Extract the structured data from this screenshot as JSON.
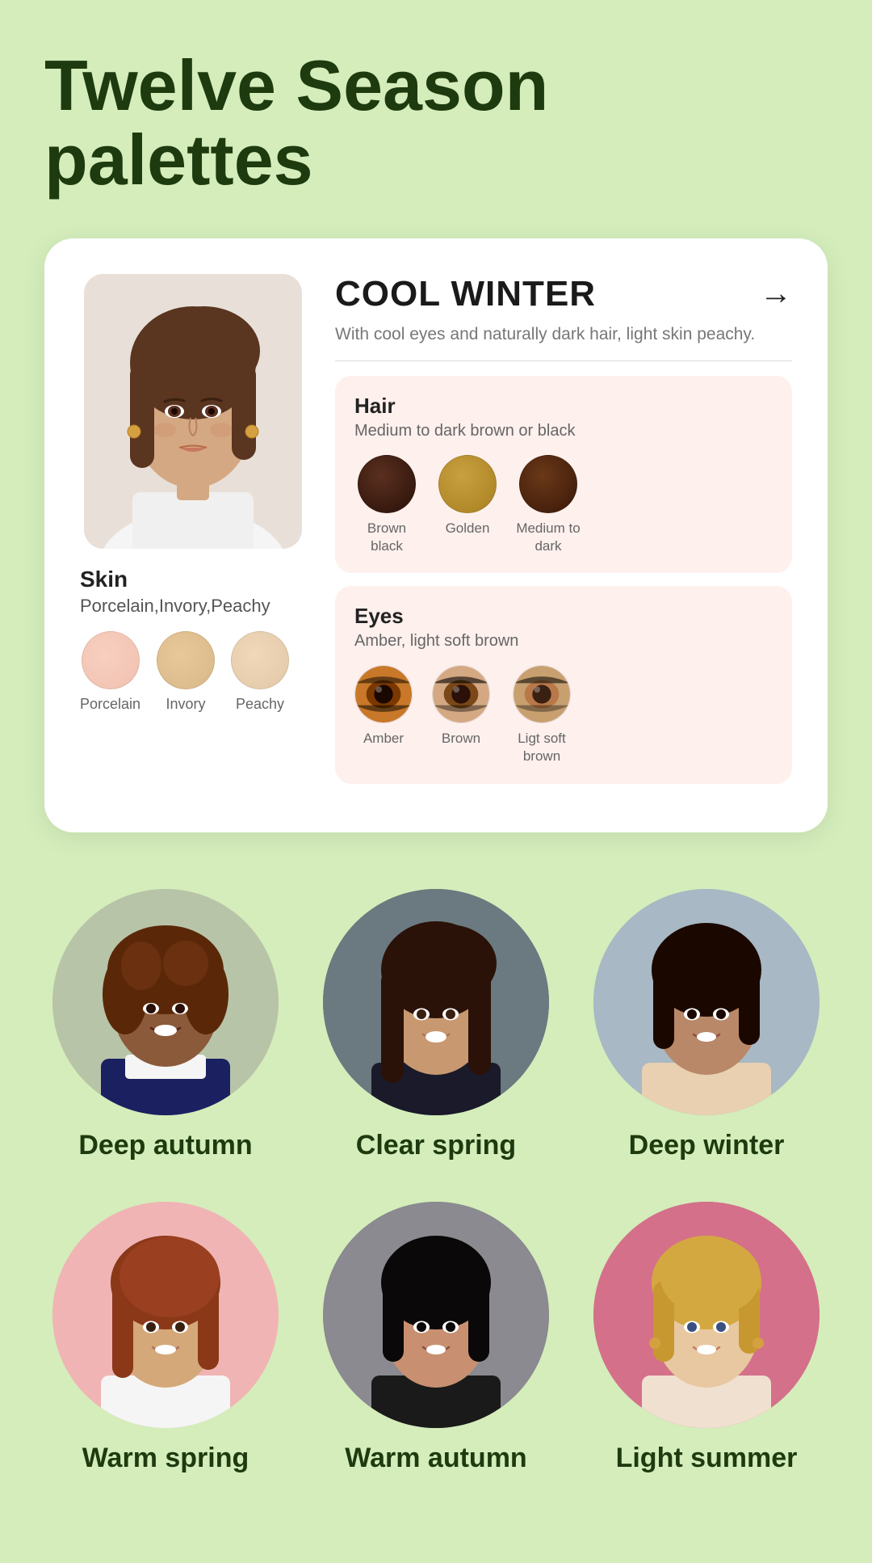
{
  "title": {
    "line1": "Twelve Season",
    "line2": "palettes"
  },
  "card": {
    "season": {
      "name": "COOL WINTER",
      "description": "With cool eyes and naturally dark hair, light skin peachy.",
      "arrow": "→"
    },
    "hair": {
      "title": "Hair",
      "subtitle": "Medium to dark brown or black",
      "swatches": [
        {
          "label": "Brown black",
          "color_class": "hair-brown-black"
        },
        {
          "label": "Golden",
          "color_class": "hair-golden"
        },
        {
          "label": "Medium to dark",
          "color_class": "hair-medium-dark"
        }
      ]
    },
    "eyes": {
      "title": "Eyes",
      "subtitle": "Amber, light soft brown",
      "swatches": [
        {
          "label": "Amber",
          "color_class": "eye-amber"
        },
        {
          "label": "Brown",
          "color_class": "eye-brown"
        },
        {
          "label": "Ligt soft brown",
          "color_class": "eye-soft-brown"
        }
      ]
    },
    "skin": {
      "title": "Skin",
      "subtitle": "Porcelain,Invory,Peachy",
      "swatches": [
        {
          "label": "Porcelain",
          "color_class": "porcelain"
        },
        {
          "label": "Invory",
          "color_class": "ivory"
        },
        {
          "label": "Peachy",
          "color_class": "peachy"
        }
      ]
    }
  },
  "profiles_row1": [
    {
      "name": "Deep autumn",
      "bg_class": "bg-neutral"
    },
    {
      "name": "Clear spring",
      "bg_class": "bg-dark"
    },
    {
      "name": "Deep winter",
      "bg_class": "bg-med"
    }
  ],
  "profiles_row2": [
    {
      "name": "Warm spring",
      "bg_class": "bg-pink"
    },
    {
      "name": "Warm autumn",
      "bg_class": "bg-gray"
    },
    {
      "name": "Light summer",
      "bg_class": "bg-rose"
    }
  ]
}
